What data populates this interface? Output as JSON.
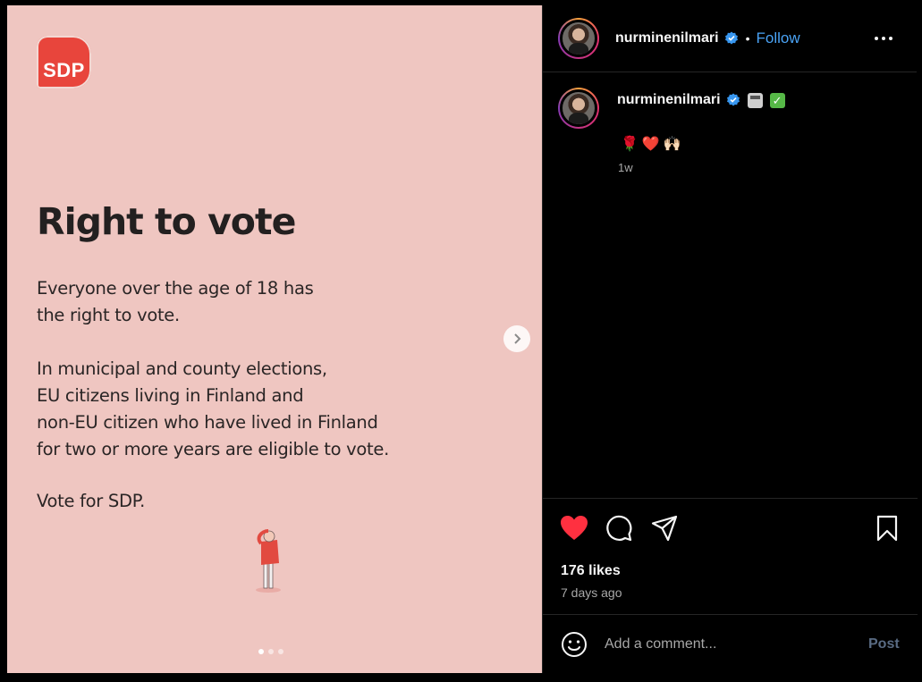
{
  "slide": {
    "logo_text": "SDP",
    "headline": "Right to vote",
    "paragraph1": "Everyone over the age of 18 has\nthe right to vote.",
    "paragraph2": "In municipal and county elections,\nEU citizens living in Finland and\nnon-EU citizen who have lived in Finland\nfor two or more years are eligible to vote.",
    "paragraph3": "Vote for SDP.",
    "slide_count": 3,
    "active_slide": 1,
    "background_color": "#efc6c1",
    "accent_color": "#e8453c"
  },
  "header": {
    "username": "nurminenilmari",
    "bullet": "•",
    "follow_label": "Follow"
  },
  "caption": {
    "username": "nurminenilmari",
    "emojis": "🌹❤️🙌🏻",
    "time": "1w"
  },
  "actions": {
    "likes": "176 likes",
    "date": "7 days ago",
    "liked": true,
    "like_color": "#ff3040"
  },
  "comment": {
    "placeholder": "Add a comment...",
    "post_label": "Post"
  },
  "icons": [
    "verified-badge-icon",
    "more-options-icon",
    "heart-icon",
    "comment-icon",
    "share-icon",
    "bookmark-icon",
    "emoji-icon",
    "chevron-right-icon"
  ]
}
